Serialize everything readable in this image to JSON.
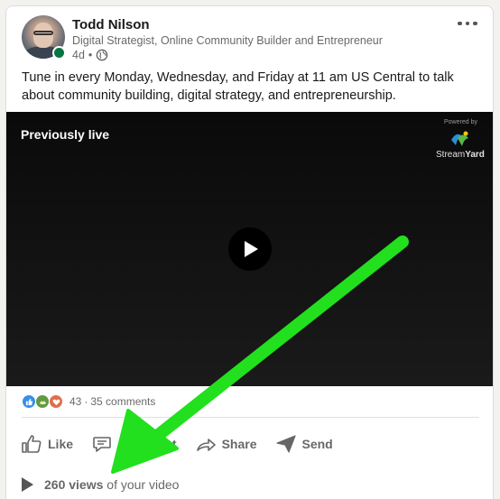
{
  "author": {
    "name": "Todd Nilson",
    "headline": "Digital Strategist, Online Community Builder and Entrepreneur",
    "time": "4d",
    "separator": "•",
    "online": true
  },
  "post": {
    "text": "Tune in every Monday, Wednesday, and Friday at 11 am US Central to talk about community building, digital strategy, and entrepreneurship."
  },
  "video": {
    "status_label": "Previously live",
    "powered_by": "Powered by",
    "brand_stream": "Stream",
    "brand_yard": "Yard"
  },
  "social": {
    "reactions": [
      "like-reaction-icon",
      "support-reaction-icon",
      "love-reaction-icon"
    ],
    "reaction_count": "43",
    "dot": "·",
    "comments": "35 comments"
  },
  "actions": {
    "like": "Like",
    "comment": "Comment",
    "share": "Share",
    "send": "Send"
  },
  "views": {
    "count": "260 views",
    "suffix": "of your video"
  },
  "colors": {
    "online": "#057642",
    "like_reaction": "#378fe9",
    "support_reaction": "#5f9b41",
    "love_reaction": "#df704d",
    "annotation_arrow": "#22e01e"
  }
}
